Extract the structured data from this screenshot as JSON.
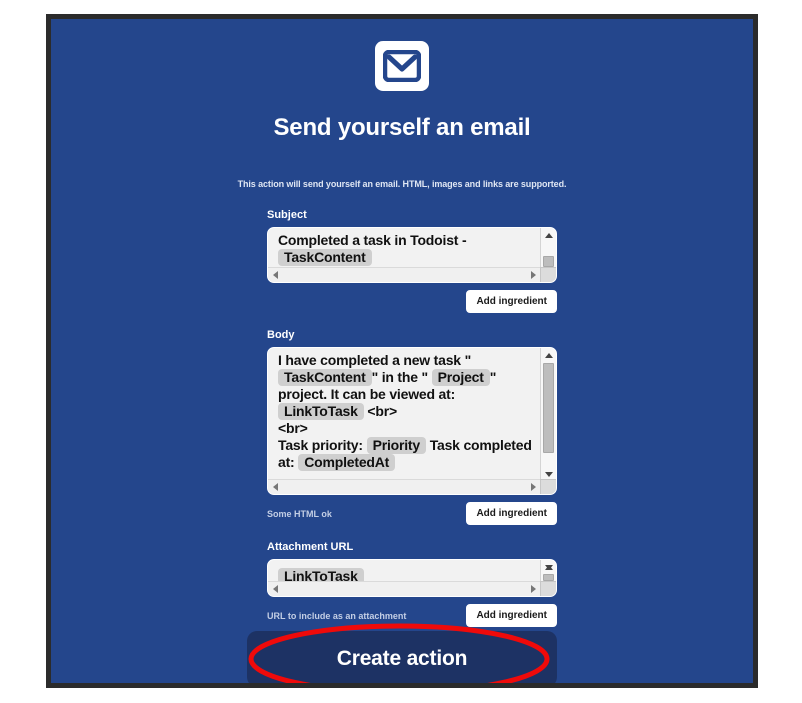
{
  "app": {
    "logo_icon": "gmail-envelope-m-icon",
    "title": "Send yourself an email",
    "subtitle": "This action will send yourself an email. HTML, images and links are supported."
  },
  "colors": {
    "background_blue": "#24468c",
    "button_navy": "#1d3264",
    "frame_border": "#2b2b2b",
    "annotation_red": "#ef0a0a",
    "token_grey": "#cfcfcf",
    "helper_text": "#c3cee5"
  },
  "fields": {
    "subject": {
      "label": "Subject",
      "text_before": "Completed a task in Todoist - ",
      "tokens": [
        "TaskContent"
      ],
      "add_button": "Add ingredient",
      "helper": ""
    },
    "body": {
      "label": "Body",
      "line1_pre": "I have completed a new task \"",
      "token1": "TaskContent",
      "line2_mid": "\" in the \"",
      "token2": "Project",
      "line2_end": "\"",
      "line3": "project. It can be viewed at:",
      "token3": "LinkToTask",
      "line4_tail": "<br>",
      "line5": "<br>",
      "line6_pre": "Task priority:",
      "token4": "Priority",
      "line6_mid": "Task",
      "line7_pre": "completed at:",
      "token5": "CompletedAt",
      "add_button": "Add ingredient",
      "helper": "Some HTML ok"
    },
    "attachment": {
      "label": "Attachment URL",
      "token": "LinkToTask",
      "add_button": "Add ingredient",
      "helper": "URL to include as an attachment"
    }
  },
  "submit": {
    "label": "Create action"
  },
  "annotation": {
    "shape": "red-ellipse-highlight",
    "target": "create-action-button"
  }
}
